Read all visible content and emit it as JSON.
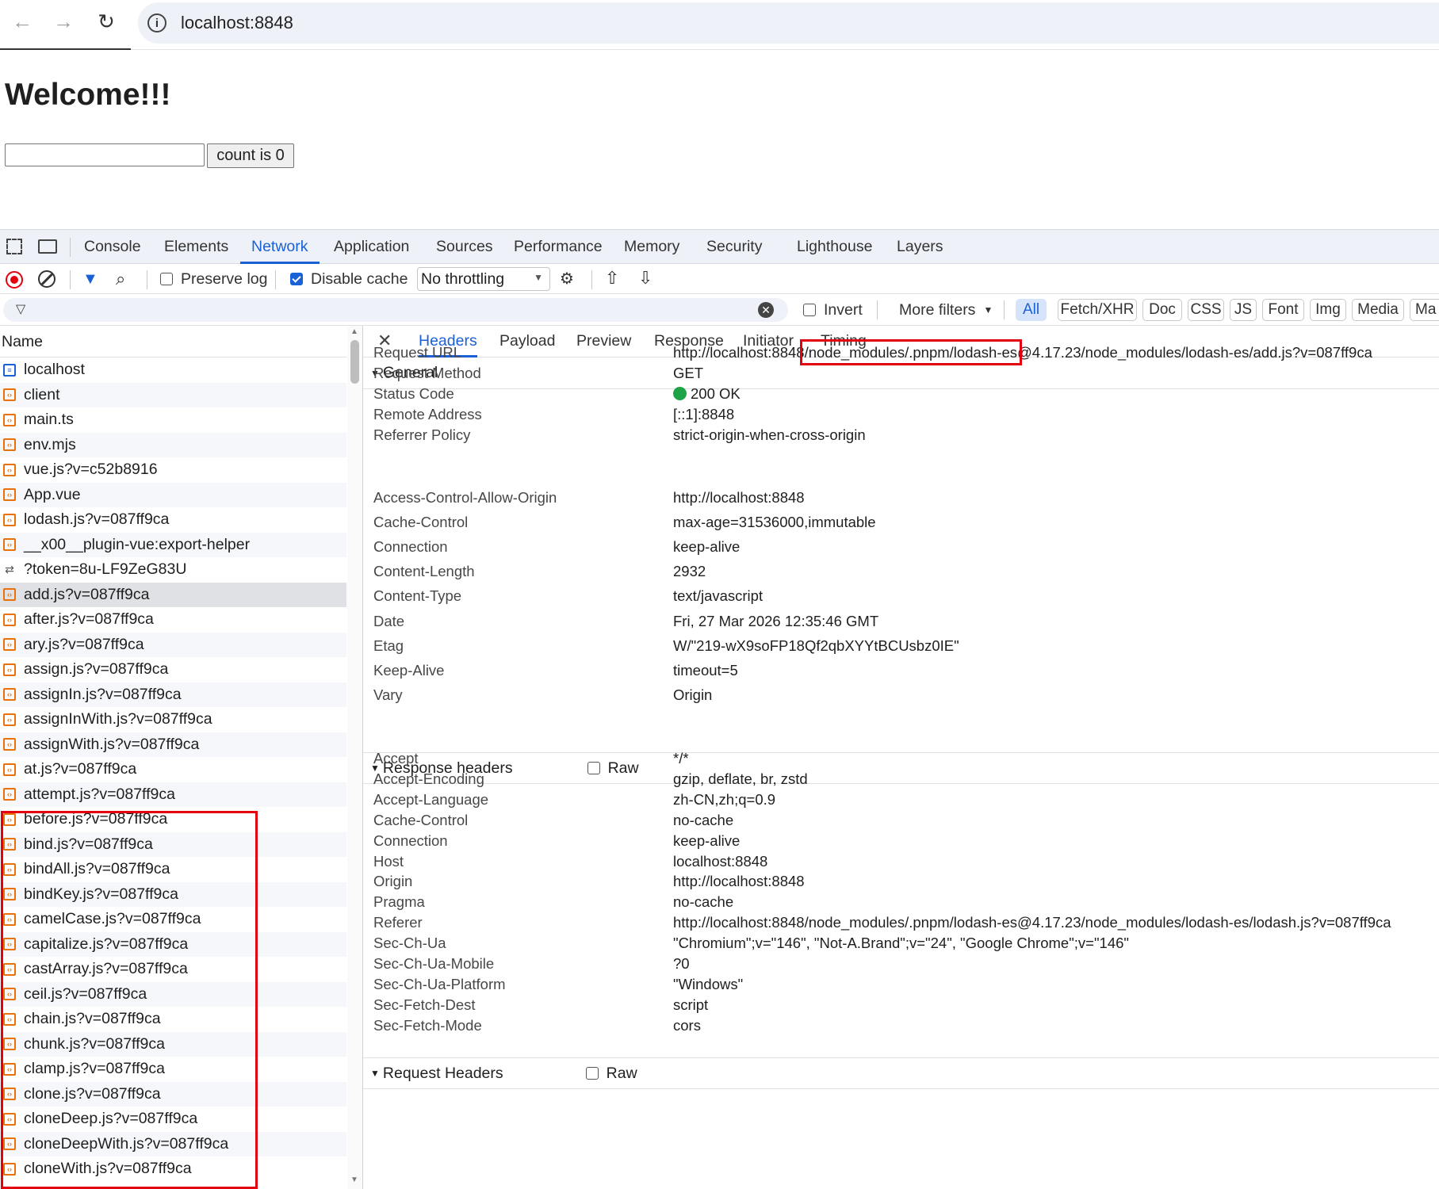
{
  "browser": {
    "url": "localhost:8848"
  },
  "page": {
    "title": "Welcome!!!",
    "input_value": "",
    "button_label": "count is 0"
  },
  "devtools": {
    "tabs": [
      "Console",
      "Elements",
      "Network",
      "Application",
      "Sources",
      "Performance",
      "Memory",
      "Security",
      "Lighthouse",
      "Layers"
    ],
    "active_tab": "Network",
    "toolbar": {
      "preserve_log": "Preserve log",
      "disable_cache": "Disable cache",
      "throttling": "No throttling"
    },
    "filter": {
      "invert": "Invert",
      "more_filters": "More filters",
      "types": [
        "All",
        "Fetch/XHR",
        "Doc",
        "CSS",
        "JS",
        "Font",
        "Img",
        "Media",
        "Ma"
      ]
    },
    "request_list": {
      "header": "Name",
      "rows": [
        {
          "name": "localhost",
          "icon": "document-icon"
        },
        {
          "name": "client",
          "icon": "script-icon"
        },
        {
          "name": "main.ts",
          "icon": "script-icon"
        },
        {
          "name": "env.mjs",
          "icon": "script-icon"
        },
        {
          "name": "vue.js?v=c52b8916",
          "icon": "script-icon"
        },
        {
          "name": "App.vue",
          "icon": "script-icon"
        },
        {
          "name": "lodash.js?v=087ff9ca",
          "icon": "script-icon"
        },
        {
          "name": "__x00__plugin-vue:export-helper",
          "icon": "script-icon"
        },
        {
          "name": "?token=8u-LF9ZeG83U",
          "icon": "websocket-icon"
        },
        {
          "name": "add.js?v=087ff9ca",
          "icon": "script-icon"
        },
        {
          "name": "after.js?v=087ff9ca",
          "icon": "script-icon"
        },
        {
          "name": "ary.js?v=087ff9ca",
          "icon": "script-icon"
        },
        {
          "name": "assign.js?v=087ff9ca",
          "icon": "script-icon"
        },
        {
          "name": "assignIn.js?v=087ff9ca",
          "icon": "script-icon"
        },
        {
          "name": "assignInWith.js?v=087ff9ca",
          "icon": "script-icon"
        },
        {
          "name": "assignWith.js?v=087ff9ca",
          "icon": "script-icon"
        },
        {
          "name": "at.js?v=087ff9ca",
          "icon": "script-icon"
        },
        {
          "name": "attempt.js?v=087ff9ca",
          "icon": "script-icon"
        },
        {
          "name": "before.js?v=087ff9ca",
          "icon": "script-icon"
        },
        {
          "name": "bind.js?v=087ff9ca",
          "icon": "script-icon"
        },
        {
          "name": "bindAll.js?v=087ff9ca",
          "icon": "script-icon"
        },
        {
          "name": "bindKey.js?v=087ff9ca",
          "icon": "script-icon"
        },
        {
          "name": "camelCase.js?v=087ff9ca",
          "icon": "script-icon"
        },
        {
          "name": "capitalize.js?v=087ff9ca",
          "icon": "script-icon"
        },
        {
          "name": "castArray.js?v=087ff9ca",
          "icon": "script-icon"
        },
        {
          "name": "ceil.js?v=087ff9ca",
          "icon": "script-icon"
        },
        {
          "name": "chain.js?v=087ff9ca",
          "icon": "script-icon"
        },
        {
          "name": "chunk.js?v=087ff9ca",
          "icon": "script-icon"
        },
        {
          "name": "clamp.js?v=087ff9ca",
          "icon": "script-icon"
        },
        {
          "name": "clone.js?v=087ff9ca",
          "icon": "script-icon"
        },
        {
          "name": "cloneDeep.js?v=087ff9ca",
          "icon": "script-icon"
        },
        {
          "name": "cloneDeepWith.js?v=087ff9ca",
          "icon": "script-icon"
        },
        {
          "name": "cloneWith.js?v=087ff9ca",
          "icon": "script-icon"
        }
      ],
      "selected": "add.js?v=087ff9ca"
    },
    "details": {
      "tabs": [
        "Headers",
        "Payload",
        "Preview",
        "Response",
        "Initiator",
        "Timing"
      ],
      "active_tab": "Headers",
      "general": {
        "title": "General",
        "request_url_prefix": "http://localhost:8848",
        "request_url_highlight": "/node_modules/.pnpm/lodash-es",
        "request_url_suffix": "@4.17.23/node_modules/lodash-es/add.js?v=087ff9ca",
        "rows": [
          {
            "key": "Request URL",
            "value": ""
          },
          {
            "key": "Request Method",
            "value": "GET"
          },
          {
            "key": "Status Code",
            "value": "200 OK"
          },
          {
            "key": "Remote Address",
            "value": "[::1]:8848"
          },
          {
            "key": "Referrer Policy",
            "value": "strict-origin-when-cross-origin"
          }
        ]
      },
      "response_headers": {
        "title": "Response headers",
        "raw_label": "Raw",
        "rows": [
          {
            "key": "Access-Control-Allow-Origin",
            "value": "http://localhost:8848"
          },
          {
            "key": "Cache-Control",
            "value": "max-age=31536000,immutable"
          },
          {
            "key": "Connection",
            "value": "keep-alive"
          },
          {
            "key": "Content-Length",
            "value": "2932"
          },
          {
            "key": "Content-Type",
            "value": "text/javascript"
          },
          {
            "key": "Date",
            "value": "Fri, 27 Mar 2026 12:35:46 GMT"
          },
          {
            "key": "Etag",
            "value": "W/\"219-wX9soFP18Qf2qbXYYtBCUsbz0IE\""
          },
          {
            "key": "Keep-Alive",
            "value": "timeout=5"
          },
          {
            "key": "Vary",
            "value": "Origin"
          }
        ]
      },
      "request_headers": {
        "title": "Request Headers",
        "raw_label": "Raw",
        "rows": [
          {
            "key": "Accept",
            "value": "*/*"
          },
          {
            "key": "Accept-Encoding",
            "value": "gzip, deflate, br, zstd"
          },
          {
            "key": "Accept-Language",
            "value": "zh-CN,zh;q=0.9"
          },
          {
            "key": "Cache-Control",
            "value": "no-cache"
          },
          {
            "key": "Connection",
            "value": "keep-alive"
          },
          {
            "key": "Host",
            "value": "localhost:8848"
          },
          {
            "key": "Origin",
            "value": "http://localhost:8848"
          },
          {
            "key": "Pragma",
            "value": "no-cache"
          },
          {
            "key": "Referer",
            "value": "http://localhost:8848/node_modules/.pnpm/lodash-es@4.17.23/node_modules/lodash-es/lodash.js?v=087ff9ca"
          },
          {
            "key": "Sec-Ch-Ua",
            "value": "\"Chromium\";v=\"146\", \"Not-A.Brand\";v=\"24\", \"Google Chrome\";v=\"146\""
          },
          {
            "key": "Sec-Ch-Ua-Mobile",
            "value": "?0"
          },
          {
            "key": "Sec-Ch-Ua-Platform",
            "value": "\"Windows\""
          },
          {
            "key": "Sec-Fetch-Dest",
            "value": "script"
          },
          {
            "key": "Sec-Fetch-Mode",
            "value": "cors"
          }
        ]
      }
    }
  },
  "colors": {
    "accent": "#1a61d6",
    "highlight_box": "#e3000f",
    "status_ok": "#1ea446",
    "record_red": "#e3000f"
  }
}
